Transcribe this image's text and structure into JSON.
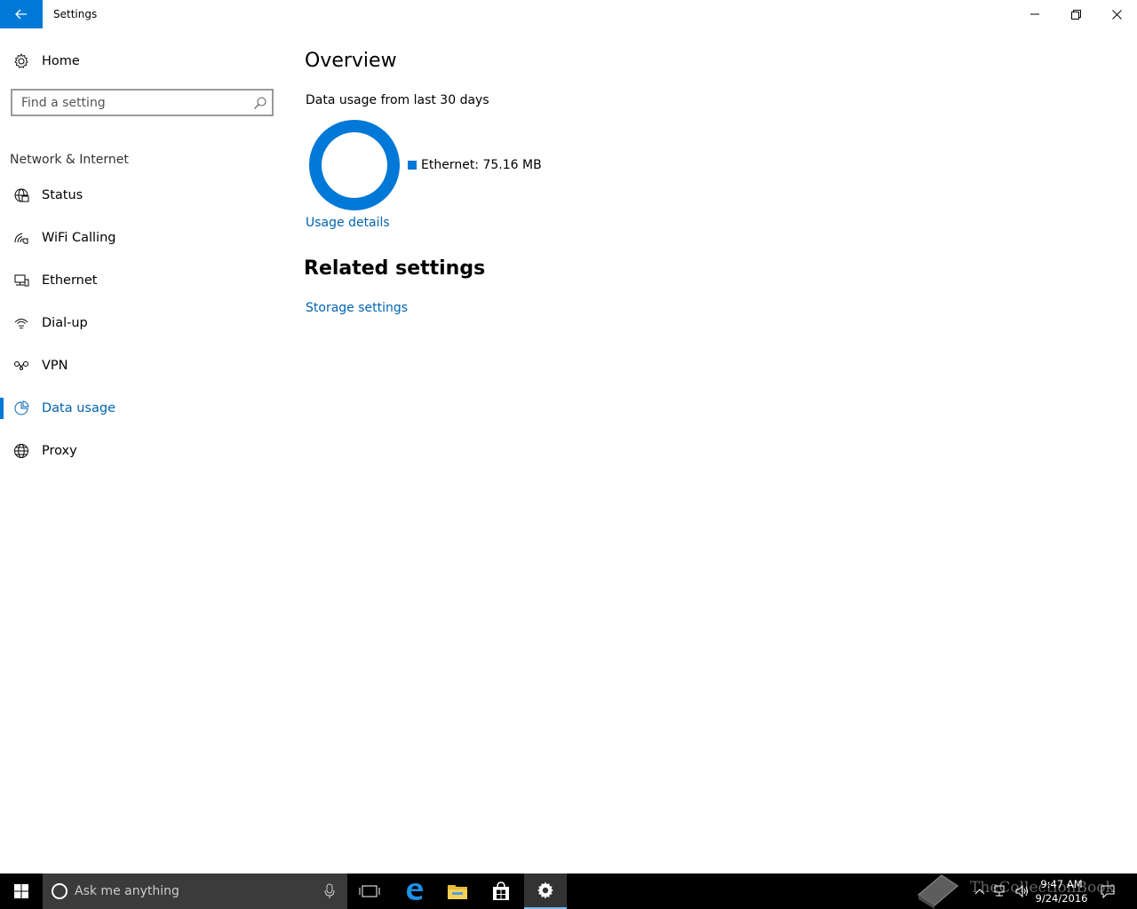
{
  "window": {
    "title": "Settings",
    "back_icon": "back-arrow-icon",
    "controls": [
      "minimize-icon",
      "restore-icon",
      "close-icon"
    ]
  },
  "sidebar": {
    "home_label": "Home",
    "search_placeholder": "Find a setting",
    "section_header": "Network & Internet",
    "items": [
      {
        "label": "Status",
        "icon": "globe-status-icon",
        "selected": false
      },
      {
        "label": "WiFi Calling",
        "icon": "wifi-calling-icon",
        "selected": false
      },
      {
        "label": "Ethernet",
        "icon": "ethernet-icon",
        "selected": false
      },
      {
        "label": "Dial-up",
        "icon": "dialup-icon",
        "selected": false
      },
      {
        "label": "VPN",
        "icon": "vpn-icon",
        "selected": false
      },
      {
        "label": "Data usage",
        "icon": "pie-chart-icon",
        "selected": true
      },
      {
        "label": "Proxy",
        "icon": "globe-icon",
        "selected": false
      }
    ]
  },
  "main": {
    "overview_title": "Overview",
    "usage_subtitle": "Data usage from last 30 days",
    "legend_label": "Ethernet: 75.16 MB",
    "usage_details_link": "Usage details",
    "related_title": "Related settings",
    "storage_settings_link": "Storage settings"
  },
  "chart_data": {
    "type": "pie",
    "categories": [
      "Ethernet"
    ],
    "values": [
      75.16
    ],
    "unit": "MB",
    "legend_placement": "right"
  },
  "taskbar": {
    "search_placeholder": "Ask me anything",
    "time": "9:47 AM",
    "date": "9/24/2016",
    "watermark_text": "TheCollectionBook"
  },
  "colors": {
    "accent": "#0078d7",
    "link": "#0063b1",
    "taskbar": "#000000"
  }
}
